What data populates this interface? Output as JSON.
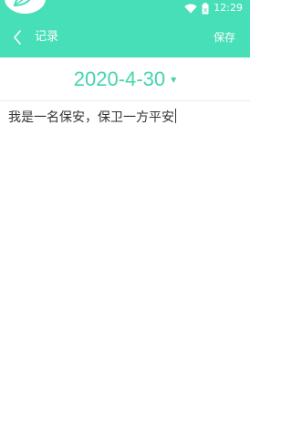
{
  "status_bar": {
    "time": "12:29",
    "battery_level": "x",
    "icons": [
      "wifi-icon",
      "battery-icon"
    ]
  },
  "app_bar": {
    "back_icon": "chevron-left-icon",
    "title": "记录",
    "save_label": "保存",
    "background": "#47dfb7"
  },
  "date": {
    "value": "2020-4-30",
    "dropdown_icon": "triangle-down-icon",
    "color": "#45d4ad"
  },
  "note": {
    "content": "我是一名保安，保卫一方平安"
  }
}
